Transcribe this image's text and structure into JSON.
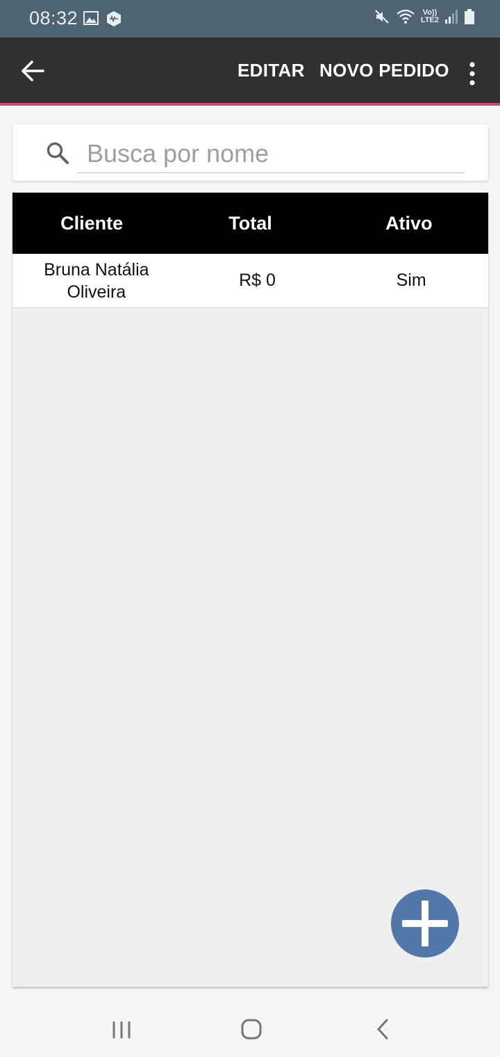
{
  "status_bar": {
    "time": "08:32",
    "left_icons": [
      "image-icon",
      "app-notification-icon"
    ],
    "right_icons": [
      "mute-icon",
      "wifi-icon",
      "volte-icon",
      "signal-icon",
      "battery-icon"
    ],
    "volte_line1": "Vo))",
    "volte_line2": "LTE2"
  },
  "app_bar": {
    "back_icon": "arrow-left-icon",
    "edit_label": "EDITAR",
    "new_order_label": "NOVO PEDIDO",
    "more_icon": "more-vert-icon",
    "accent_color": "#e0436a"
  },
  "search": {
    "placeholder": "Busca por nome",
    "value": ""
  },
  "table": {
    "columns": [
      "Cliente",
      "Total",
      "Ativo"
    ],
    "rows": [
      {
        "client": "Bruna Natália Oliveira",
        "total": "R$ 0",
        "active": "Sim"
      }
    ]
  },
  "fab": {
    "icon": "plus-icon",
    "color": "#5178a8"
  },
  "nav_bar": {
    "icons": [
      "recent-apps-icon",
      "home-icon",
      "back-icon"
    ]
  }
}
